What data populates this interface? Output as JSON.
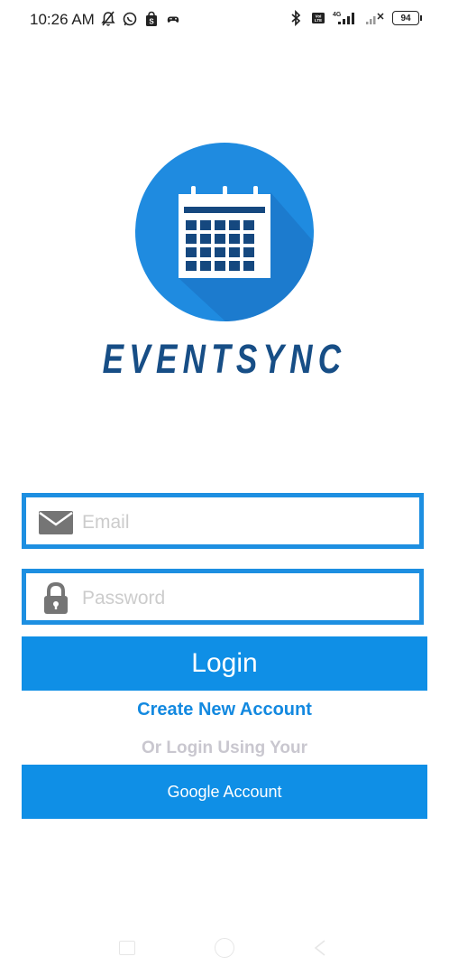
{
  "status_bar": {
    "time": "10:26 AM",
    "battery": "94",
    "left_icons": [
      "notifications-off-icon",
      "whatsapp-icon",
      "shopping-bag-icon",
      "gamepad-icon"
    ],
    "right_icons": [
      "bluetooth-icon",
      "volte-icon",
      "signal-4g-icon",
      "signal-no-sim-icon",
      "battery-icon"
    ]
  },
  "logo": {
    "icon": "calendar-icon",
    "brand": "EVENTSYNC",
    "circle_color": "#1f8be0",
    "brand_color": "#174e86"
  },
  "form": {
    "email_placeholder": "Email",
    "email_value": "",
    "email_icon": "envelope-icon",
    "password_placeholder": "Password",
    "password_value": "",
    "password_icon": "lock-icon",
    "field_border_color": "#1d8fe1"
  },
  "actions": {
    "login_label": "Login",
    "create_account_label": "Create New Account",
    "or_login_text": "Or Login Using Your",
    "google_label": "Google Account",
    "button_color": "#0f8fe6"
  },
  "nav_bar": {
    "icons": [
      "recent-apps-icon",
      "home-icon",
      "back-icon"
    ]
  }
}
